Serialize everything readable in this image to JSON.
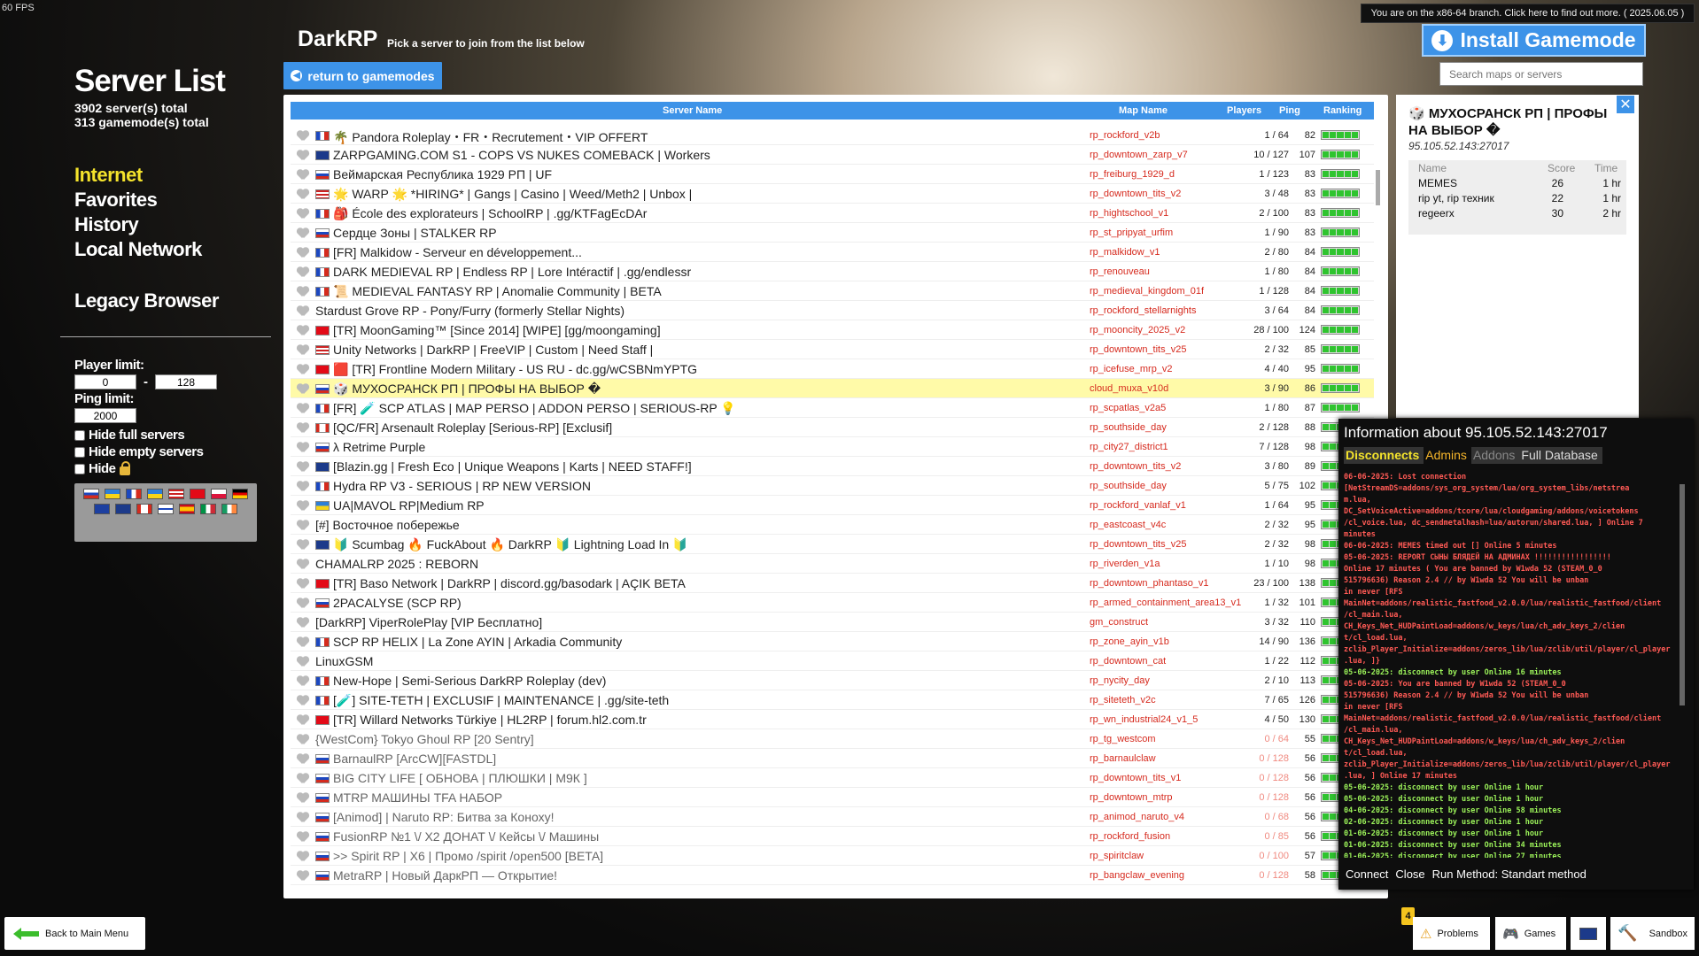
{
  "fps": "60 FPS",
  "left": {
    "title": "Server List",
    "servers_total": "3902 server(s) total",
    "gamemodes_total": "313 gamemode(s) total",
    "nav": [
      "Internet",
      "Favorites",
      "History",
      "Local Network"
    ],
    "legacy": "Legacy Browser"
  },
  "filters": {
    "player_limit_label": "Player limit:",
    "player_min": "0",
    "player_max": "128",
    "dash": "-",
    "ping_limit_label": "Ping limit:",
    "ping_limit": "2000",
    "hide_full": "Hide full servers",
    "hide_empty": "Hide empty servers",
    "hide_locked": "Hide"
  },
  "header": {
    "title": "DarkRP",
    "subtitle": "Pick a server to join from the list below",
    "return_button": "return to gamemodes",
    "branch_notice": "You are on the x86-64 branch. Click here to find out more. ( 2025.06.05 )",
    "install_button": "Install Gamemode",
    "search_placeholder": "Search maps or servers"
  },
  "columns": {
    "name": "Server Name",
    "map": "Map Name",
    "players": "Players",
    "ping": "Ping",
    "ranking": "Ranking"
  },
  "servers": [
    {
      "name": "🌴 Pandora Roleplay・FR・Recrutement・VIP OFFERT",
      "map": "rp_rockford_v2b",
      "players": "1 / 64",
      "ping": "82",
      "flag": "fr"
    },
    {
      "name": "ZARPGAMING.COM S1 - COPS VS NUKES COMEBACK | Workers",
      "map": "rp_downtown_zarp_v7",
      "players": "10 / 127",
      "ping": "107",
      "flag": "gb"
    },
    {
      "name": "Веймарская Республика 1929 РП | UF",
      "map": "rp_freiburg_1929_d",
      "players": "1 / 123",
      "ping": "83",
      "flag": "ru"
    },
    {
      "name": "🌟 WARP 🌟 *HIRING* | Gangs | Casino | Weed/Meth2 | Unbox |",
      "map": "rp_downtown_tits_v2",
      "players": "3 / 48",
      "ping": "83",
      "flag": "us"
    },
    {
      "name": "🎒 École des explorateurs | SchoolRP | .gg/KTFagEcDAr",
      "map": "rp_hightschool_v1",
      "players": "2 / 100",
      "ping": "83",
      "flag": "fr"
    },
    {
      "name": "Сердце Зоны | STALKER RP",
      "map": "rp_st_pripyat_urfim",
      "players": "1 / 90",
      "ping": "83",
      "flag": "ru"
    },
    {
      "name": "[FR] Malkidow - Serveur en développement...",
      "map": "rp_malkidow_v1",
      "players": "2 / 80",
      "ping": "84",
      "flag": "fr"
    },
    {
      "name": "DARK MEDIEVAL RP | Endless RP | Lore Intéractif | .gg/endlessr",
      "map": "rp_renouveau",
      "players": "1 / 80",
      "ping": "84",
      "flag": "fr"
    },
    {
      "name": "📜 MEDIEVAL FANTASY RP | Anomalie Community | BETA",
      "map": "rp_medieval_kingdom_01f",
      "players": "1 / 128",
      "ping": "84",
      "flag": "fr"
    },
    {
      "name": "Stardust Grove RP - Pony/Furry (formerly Stellar Nights)",
      "map": "rp_rockford_stellarnights",
      "players": "3 / 64",
      "ping": "84",
      "flag": ""
    },
    {
      "name": "[TR] MoonGaming™ [Since 2014] [WIPE] [gg/moongaming]",
      "map": "rp_mooncity_2025_v2",
      "players": "28 / 100",
      "ping": "124",
      "flag": "tr"
    },
    {
      "name": "Unity Networks | DarkRP | FreeVIP | Custom | Need Staff |",
      "map": "rp_downtown_tits_v25",
      "players": "2 / 32",
      "ping": "85",
      "flag": "us"
    },
    {
      "name": "🟥 [TR] Frontline Modern Military - US RU - dc.gg/wCSBNmYPTG",
      "map": "rp_icefuse_mrp_v2",
      "players": "4 / 40",
      "ping": "95",
      "flag": "tr"
    },
    {
      "name": "🎲 МУХОСРАНСК РП | ПРОФЫ НА ВЫБОР �",
      "map": "cloud_muxa_v10d",
      "players": "3 / 90",
      "ping": "86",
      "flag": "ru",
      "selected": true
    },
    {
      "name": "[FR] 🧪 SCP ATLAS | MAP PERSO | ADDON PERSO | SERIOUS-RP 💡",
      "map": "rp_scpatlas_v2a5",
      "players": "1 / 80",
      "ping": "87",
      "flag": "fr"
    },
    {
      "name": "[QC/FR] Arsenault Roleplay [Serious-RP] [Exclusif]",
      "map": "rp_southside_day",
      "players": "2 / 128",
      "ping": "88",
      "flag": "ca"
    },
    {
      "name": "λ Retrime Purple",
      "map": "rp_city27_district1",
      "players": "7 / 128",
      "ping": "98",
      "flag": "ru"
    },
    {
      "name": "[Blazin.gg | Fresh Eco | Unique Weapons | Karts | NEED STAFF!]",
      "map": "rp_downtown_tits_v2",
      "players": "3 / 80",
      "ping": "89",
      "flag": "gb"
    },
    {
      "name": "Hydra RP V3 - SERIOUS | RP NEW VERSION",
      "map": "rp_southside_day",
      "players": "5 / 75",
      "ping": "102",
      "flag": "fr"
    },
    {
      "name": "UA|MAVOL RP|Medium RP",
      "map": "rp_rockford_vanlaf_v1",
      "players": "1 / 64",
      "ping": "95",
      "flag": "ua"
    },
    {
      "name": "[#] Восточное побережье",
      "map": "rp_eastcoast_v4c",
      "players": "2 / 32",
      "ping": "95",
      "flag": ""
    },
    {
      "name": "🔰 Scumbag 🔥 FuckAbout 🔥 DarkRP 🔰 Lightning Load In 🔰",
      "map": "rp_downtown_tits_v25",
      "players": "2 / 32",
      "ping": "98",
      "flag": "gb"
    },
    {
      "name": "CHAMALRP 2025 : REBORN",
      "map": "rp_riverden_v1a",
      "players": "1 / 10",
      "ping": "98",
      "flag": ""
    },
    {
      "name": "[TR] Baso Network | DarkRP | discord.gg/basodark | AÇIK BETA",
      "map": "rp_downtown_phantaso_v1",
      "players": "23 / 100",
      "ping": "138",
      "flag": "tr"
    },
    {
      "name": "2PACALYSE (SCP RP)",
      "map": "rp_armed_containment_area13_v1",
      "players": "1 / 32",
      "ping": "101",
      "flag": "ru"
    },
    {
      "name": "[DarkRP] ViperRolePlay [VIP Бесплатно]",
      "map": "gm_construct",
      "players": "3 / 32",
      "ping": "110",
      "flag": ""
    },
    {
      "name": "SCP RP HELIX | La Zone AYIN | Arkadia Community",
      "map": "rp_zone_ayin_v1b",
      "players": "14 / 90",
      "ping": "136",
      "flag": "fr"
    },
    {
      "name": "LinuxGSM",
      "map": "rp_downtown_cat",
      "players": "1 / 22",
      "ping": "112",
      "flag": ""
    },
    {
      "name": "New-Hope | Semi-Serious DarkRP Roleplay (dev)",
      "map": "rp_nycity_day",
      "players": "2 / 10",
      "ping": "113",
      "flag": "fr"
    },
    {
      "name": "[🧪] SITE-TETH | EXCLUSIF | MAINTENANCE | .gg/site-teth",
      "map": "rp_siteteth_v2c",
      "players": "7 / 65",
      "ping": "126",
      "flag": "fr"
    },
    {
      "name": "[TR] Willard Networks Türkiye | HL2RP | forum.hl2.com.tr",
      "map": "rp_wn_industrial24_v1_5",
      "players": "4 / 50",
      "ping": "130",
      "flag": "tr"
    },
    {
      "name": "{WestCom} Tokyo Ghoul RP [20 Sentry]",
      "map": "rp_tg_westcom",
      "players": "0 / 64",
      "ping": "55",
      "flag": "",
      "empty": true
    },
    {
      "name": "BarnaulRP [ArcCW][FASTDL]",
      "map": "rp_barnaulclaw",
      "players": "0 / 128",
      "ping": "56",
      "flag": "ru",
      "empty": true
    },
    {
      "name": "BIG CITY LIFE [ ОБНОВА | ПЛЮШКИ | М9К ]",
      "map": "rp_downtown_tits_v1",
      "players": "0 / 128",
      "ping": "56",
      "flag": "ru",
      "empty": true
    },
    {
      "name": "MTRP МАШИНЫ TFA НАБОР",
      "map": "rp_downtown_mtrp",
      "players": "0 / 128",
      "ping": "56",
      "flag": "ru",
      "empty": true
    },
    {
      "name": "[Animod] | Naruto RP: Битва за Коноху!",
      "map": "rp_animod_naruto_v4",
      "players": "0 / 68",
      "ping": "56",
      "flag": "ru",
      "empty": true
    },
    {
      "name": "FusionRP №1 \\/ X2 ДОНАТ \\/ Кейсы \\/ Машины",
      "map": "rp_rockford_fusion",
      "players": "0 / 85",
      "ping": "56",
      "flag": "ru",
      "empty": true
    },
    {
      "name": ">> Spirit RP | X6 | Промо /spirit /open500 [BETA]",
      "map": "rp_spiritclaw",
      "players": "0 / 100",
      "ping": "57",
      "flag": "ru",
      "empty": true
    },
    {
      "name": "MetraRP | Новый ДаркРП — Открытие!",
      "map": "rp_bangclaw_evening",
      "players": "0 / 128",
      "ping": "58",
      "flag": "ru",
      "empty": true
    }
  ],
  "detail": {
    "title": "🎲 МУХОСРАНСК РП | ПРОФЫ НА ВЫБОР �",
    "ip": "95.105.52.143:27017",
    "headers": {
      "name": "Name",
      "score": "Score",
      "time": "Time"
    },
    "players": [
      {
        "name": "MEMES",
        "score": "26",
        "time": "1 hr"
      },
      {
        "name": "rip yt, rip техник",
        "score": "22",
        "time": "1 hr"
      },
      {
        "name": "regeerx",
        "score": "30",
        "time": "2 hr"
      }
    ]
  },
  "info": {
    "title": "Information about 95.105.52.143:27017",
    "tabs": [
      "Disconnects",
      "Admins",
      "Addons",
      "Full Database"
    ],
    "log": [
      {
        "c": "r",
        "t": "06-06-2025: Lost connection"
      },
      {
        "c": "r",
        "t": "[NetStreamDS=addons/sys_org_system/lua/org_system_libs/netstrea"
      },
      {
        "c": "r",
        "t": "m.lua,"
      },
      {
        "c": "r",
        "t": "DC_SetVoiceActive=addons/tcore/lua/cloudgaming/addons/voicetokens"
      },
      {
        "c": "r",
        "t": "/cl_voice.lua, dc_sendmetalhash=lua/autorun/shared.lua, ] Online  7"
      },
      {
        "c": "r",
        "t": "minutes"
      },
      {
        "c": "r",
        "t": "06-06-2025: MEMES timed out  [] Online  5 minutes"
      },
      {
        "c": "r",
        "t": "05-06-2025: REPORT СЫНЫ БЛЯДЕЙ НА АДМИНАХ !!!!!!!!!!!!!!!!!"
      },
      {
        "c": "r",
        "t": "Online  17 minutes (          You are banned by  W1wda 52 (STEAM_0_0"
      },
      {
        "c": "r",
        "t": "515796636)         Reason  2.4 // by W1wda 52            You will be unban"
      },
      {
        "c": "r",
        "t": "in  never  [RFS"
      },
      {
        "c": "r",
        "t": "MainNet=addons/realistic_fastfood_v2.0.0/lua/realistic_fastfood/client"
      },
      {
        "c": "r",
        "t": "/cl_main.lua,"
      },
      {
        "c": "r",
        "t": "CH_Keys_Net_HUDPaintLoad=addons/w_keys/lua/ch_adv_keys_2/clien"
      },
      {
        "c": "r",
        "t": "t/cl_load.lua,"
      },
      {
        "c": "r",
        "t": "zclib_Player_Initialize=addons/zeros_lib/lua/zclib/util/player/cl_player"
      },
      {
        "c": "r",
        "t": ".lua, ]}"
      },
      {
        "c": "g",
        "t": "05-06-2025: disconnect by user Online  16 minutes"
      },
      {
        "c": "r",
        "t": "05-06-2025:              You are banned by  W1wda 52 (STEAM_0_0"
      },
      {
        "c": "r",
        "t": "515796636)         Reason  2.4 // by W1wda 52            You will be unban"
      },
      {
        "c": "r",
        "t": "in  never  [RFS"
      },
      {
        "c": "r",
        "t": "MainNet=addons/realistic_fastfood_v2.0.0/lua/realistic_fastfood/client"
      },
      {
        "c": "r",
        "t": "/cl_main.lua,"
      },
      {
        "c": "r",
        "t": "CH_Keys_Net_HUDPaintLoad=addons/w_keys/lua/ch_adv_keys_2/clien"
      },
      {
        "c": "r",
        "t": "t/cl_load.lua,"
      },
      {
        "c": "r",
        "t": "zclib_Player_Initialize=addons/zeros_lib/lua/zclib/util/player/cl_player"
      },
      {
        "c": "r",
        "t": ".lua, ] Online  17 minutes"
      },
      {
        "c": "g",
        "t": "05-06-2025: disconnect by user Online  1 hour"
      },
      {
        "c": "g",
        "t": "05-06-2025: disconnect by user Online  1 hour"
      },
      {
        "c": "g",
        "t": "04-06-2025: disconnect by user Online  58 minutes"
      },
      {
        "c": "g",
        "t": "02-06-2025: disconnect by user Online  1 hour"
      },
      {
        "c": "g",
        "t": "01-06-2025: disconnect by user Online  1 hour"
      },
      {
        "c": "g",
        "t": "01-06-2025: disconnect by user Online  34 minutes"
      },
      {
        "c": "g",
        "t": "01-06-2025: disconnect by user Online  27 minutes"
      }
    ],
    "footer": {
      "connect": "Connect",
      "close": "Close",
      "run_method": "Run Method: Standart method"
    }
  },
  "bottom": {
    "back": "Back to Main Menu",
    "problems": "Problems",
    "problems_count": "4",
    "games": "Games",
    "sandbox": "Sandbox"
  },
  "colors": {
    "accent": "#3d93e8",
    "nav_active": "#f4e32c",
    "map_text": "#d62a1e",
    "ranking": "#2fc42f",
    "selected_row": "#fffaa8"
  }
}
